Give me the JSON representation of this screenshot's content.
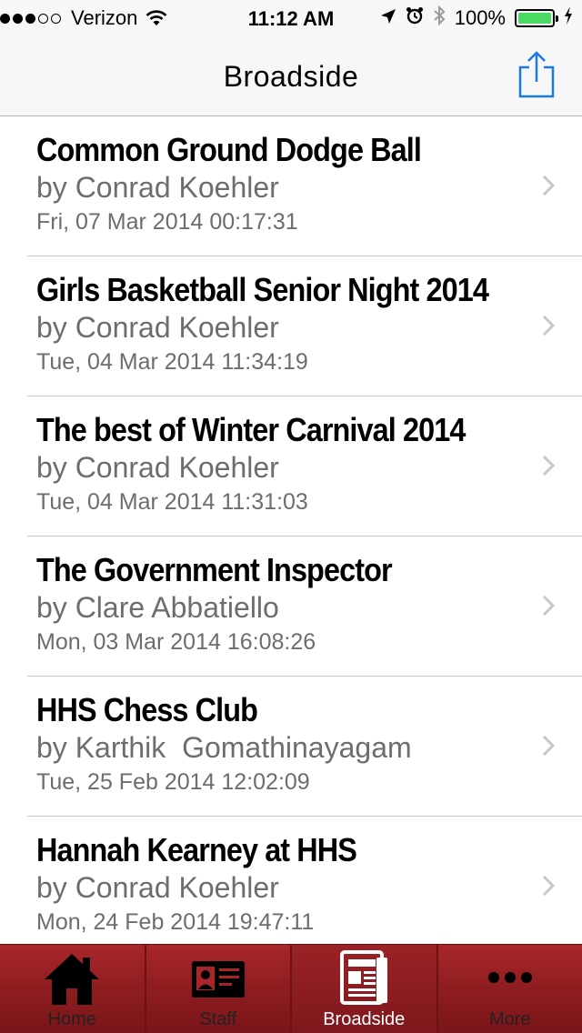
{
  "status_bar": {
    "carrier": "Verizon",
    "time": "11:12 AM",
    "battery": "100%",
    "signal_dots_filled": 3,
    "signal_dots_total": 5,
    "battery_level": 1.0,
    "battery_color": "#4cd964"
  },
  "nav": {
    "title": "Broadside",
    "share_icon": "share-icon",
    "accent_color": "#1a7be6"
  },
  "articles": [
    {
      "title": "Common Ground Dodge Ball",
      "author": "by Conrad Koehler",
      "date": "Fri, 07 Mar 2014 00:17:31"
    },
    {
      "title": "Girls Basketball Senior Night 2014",
      "author": "by Conrad Koehler",
      "date": "Tue, 04 Mar 2014 11:34:19"
    },
    {
      "title": "The best of Winter Carnival 2014",
      "author": "by Conrad Koehler",
      "date": "Tue, 04 Mar 2014 11:31:03"
    },
    {
      "title": "The Government Inspector",
      "author": "by Clare Abbatiello",
      "date": "Mon, 03 Mar 2014 16:08:26"
    },
    {
      "title": "HHS Chess Club",
      "author": "by Karthik  Gomathinayagam",
      "date": "Tue, 25 Feb 2014 12:02:09"
    },
    {
      "title": "Hannah Kearney at HHS",
      "author": "by Conrad Koehler",
      "date": "Mon, 24 Feb 2014 19:47:11"
    }
  ],
  "tabs": [
    {
      "label": "Home",
      "icon": "home-icon",
      "active": false
    },
    {
      "label": "Staff",
      "icon": "staff-id-icon",
      "active": false
    },
    {
      "label": "Broadside",
      "icon": "newspaper-icon",
      "active": true
    },
    {
      "label": "More",
      "icon": "more-dots-icon",
      "active": false
    }
  ],
  "colors": {
    "tab_bar": "#8e1d20",
    "secondary_text": "#6d6d6d",
    "chevron": "#c7c7cc"
  }
}
